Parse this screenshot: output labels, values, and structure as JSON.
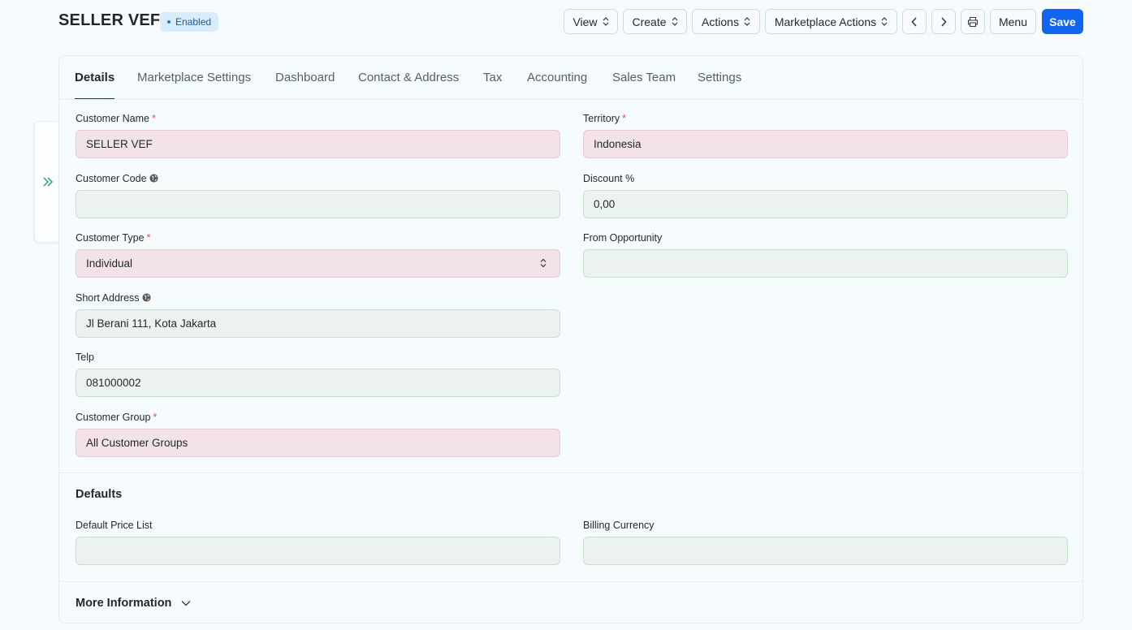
{
  "header": {
    "title": "SELLER VEF",
    "status_badge": "Enabled",
    "buttons": {
      "view": "View",
      "create": "Create",
      "actions": "Actions",
      "marketplace_actions": "Marketplace Actions",
      "menu": "Menu",
      "save": "Save"
    }
  },
  "tabs": [
    {
      "label": "Details"
    },
    {
      "label": "Marketplace Settings"
    },
    {
      "label": "Dashboard"
    },
    {
      "label": "Contact & Address"
    },
    {
      "label": "Tax"
    },
    {
      "label": "Accounting"
    },
    {
      "label": "Sales Team"
    },
    {
      "label": "Settings"
    }
  ],
  "fields": {
    "customer_name": {
      "label": "Customer Name",
      "value": "SELLER VEF"
    },
    "territory": {
      "label": "Territory",
      "value": "Indonesia"
    },
    "customer_code": {
      "label": "Customer Code",
      "value": ""
    },
    "discount": {
      "label": "Discount %",
      "value": "0,00"
    },
    "customer_type": {
      "label": "Customer Type",
      "value": "Individual"
    },
    "from_opportunity": {
      "label": "From Opportunity",
      "value": ""
    },
    "short_address": {
      "label": "Short Address",
      "value": "Jl Berani 111, Kota Jakarta"
    },
    "telp": {
      "label": "Telp",
      "value": "081000002"
    },
    "customer_group": {
      "label": "Customer Group",
      "value": "All Customer Groups"
    },
    "default_price_list": {
      "label": "Default Price List",
      "value": ""
    },
    "billing_currency": {
      "label": "Billing Currency",
      "value": ""
    }
  },
  "sections": {
    "defaults": "Defaults",
    "more_information": "More Information"
  },
  "required_marker": "*",
  "colors": {
    "primary": "#1166f0",
    "required": "#e24c4c",
    "badge_bg": "#d9ecfb",
    "sidebar_chevron": "#2aa27a"
  }
}
